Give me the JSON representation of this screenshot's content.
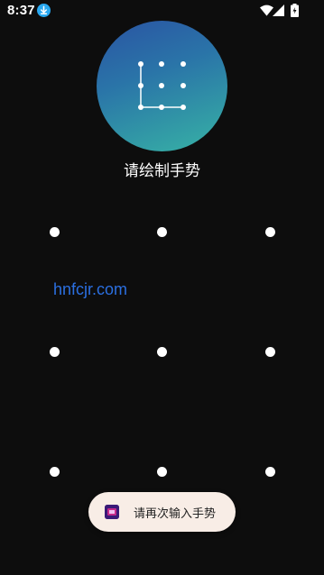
{
  "status_bar": {
    "time": "8:37",
    "icons": [
      "download-icon",
      "wifi-icon",
      "signal-icon",
      "battery-icon"
    ]
  },
  "lock_screen": {
    "avatar_icon": "pattern-lock-icon",
    "title": "请绘制手势",
    "pattern_dots": [
      {
        "id": "dot-1-1"
      },
      {
        "id": "dot-1-2"
      },
      {
        "id": "dot-1-3"
      },
      {
        "id": "dot-2-1"
      },
      {
        "id": "dot-2-2"
      },
      {
        "id": "dot-2-3"
      },
      {
        "id": "dot-3-1"
      },
      {
        "id": "dot-3-2"
      },
      {
        "id": "dot-3-3"
      }
    ]
  },
  "watermark": "hnfcjr.com",
  "toast": {
    "icon": "app-icon",
    "message": "请再次输入手势"
  },
  "colors": {
    "background": "#0d0d0d",
    "avatar_gradient_start": "#2a54a3",
    "avatar_gradient_end": "#37b3a5",
    "watermark": "#2b6fe0",
    "toast_background": "#f8ede6"
  }
}
